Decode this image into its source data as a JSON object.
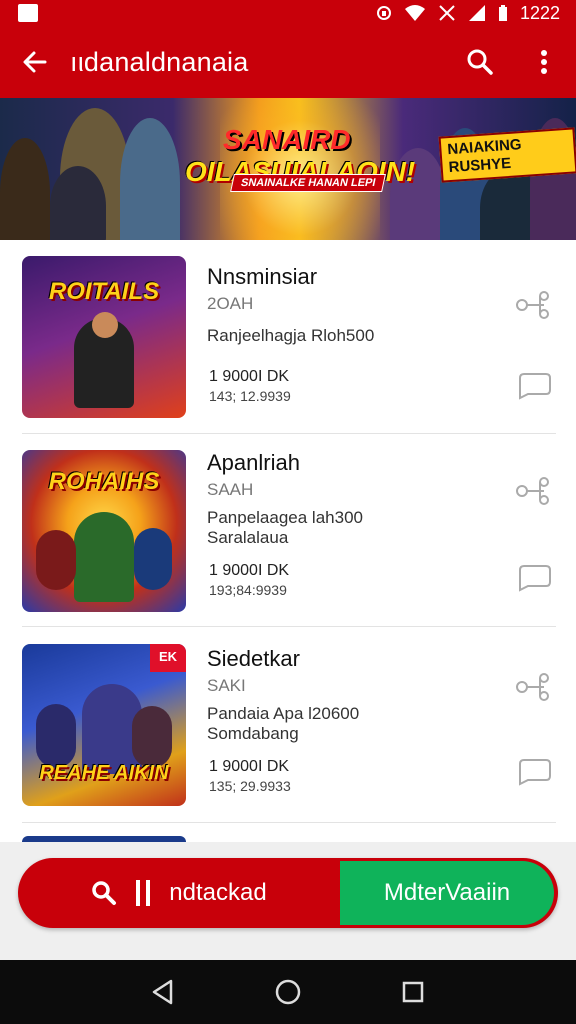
{
  "status_bar": {
    "time": "1222",
    "icons": [
      "notification-icon",
      "vpn-icon",
      "wifi-icon",
      "no-signal-icon",
      "signal-icon",
      "battery-icon"
    ]
  },
  "app_bar": {
    "title": "ıιdanaldnanaia",
    "back_icon": "arrow-back-icon",
    "search_icon": "search-icon",
    "menu_icon": "more-vert-icon",
    "color": "#c8000a"
  },
  "banner": {
    "title_line1": "SANAIRD",
    "title_line2": "OILASUIALAOIN!",
    "tag": "SNAINALKE HANAN LEPI",
    "badge": "NAIAKING RUSHYE"
  },
  "items": [
    {
      "name": "Nnsminsiar",
      "meta": "2OAH",
      "desc": "Ranjeelhagja Rloh500",
      "desc2": "",
      "downloads": "1 9000I DK",
      "date": "143; 12.9939",
      "thumb_label": "ROITAILS",
      "thumb_colors": [
        "#3a1a6b",
        "#e0401a"
      ]
    },
    {
      "name": "Apanlriah",
      "meta": "SAAH",
      "desc": "Panpelaagea lah300",
      "desc2": "Saralalaua",
      "downloads": "1 9000I DK",
      "date": "193;84:9939",
      "thumb_label": "ROHAIHS",
      "thumb_colors": [
        "#f5a21a",
        "#2a3aa8"
      ]
    },
    {
      "name": "Siedetkar",
      "meta": "SAKI",
      "desc": "Pandaia Apa l20600",
      "desc2": "Somdabang",
      "downloads": "1 9000I DK",
      "date": "135; 29.9933",
      "thumb_label": "REAHE AIKIN",
      "thumb_colors": [
        "#1a3a9a",
        "#e0a01a"
      ]
    }
  ],
  "bottom_bar": {
    "search_label": "ndtackad",
    "action_label": "MdterVaaiin",
    "accent_red": "#c8000a",
    "accent_green": "#0fb35a"
  }
}
